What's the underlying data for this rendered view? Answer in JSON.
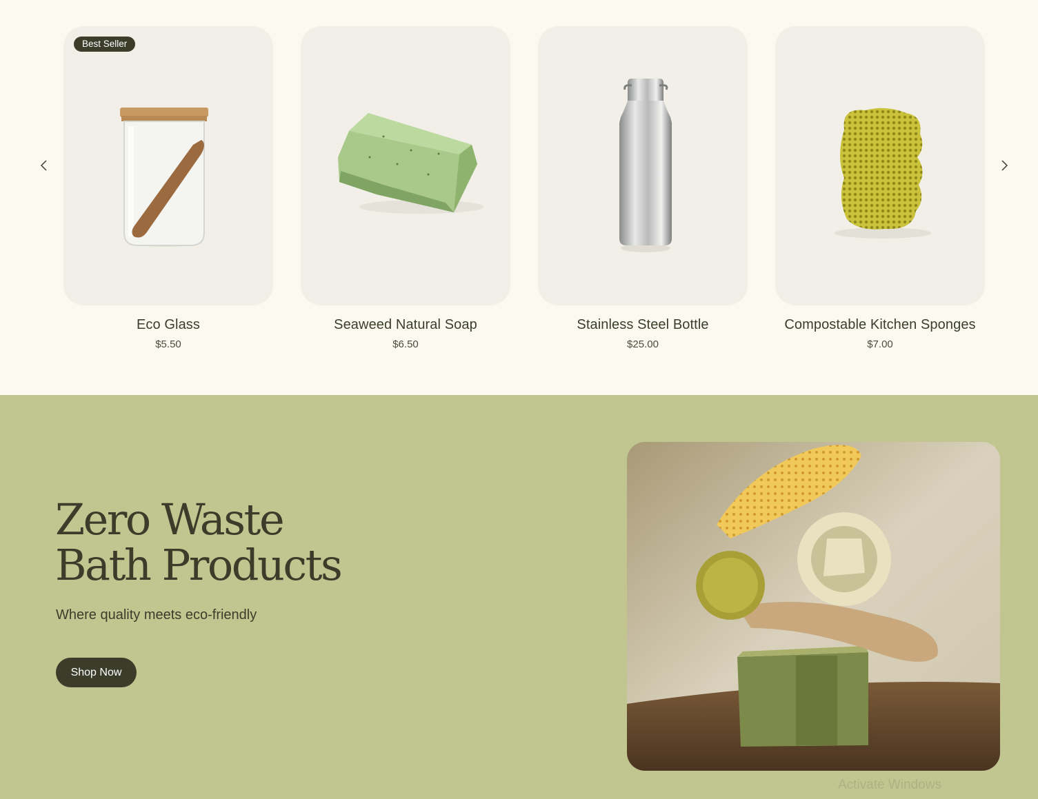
{
  "carousel": {
    "prev_icon": "chevron-left-icon",
    "next_icon": "chevron-right-icon",
    "products": [
      {
        "name": "Eco Glass",
        "price": "$5.50",
        "badge": "Best Seller",
        "image": "glass-jar-with-wooden-spoon"
      },
      {
        "name": "Seaweed Natural Soap",
        "price": "$6.50",
        "badge": "",
        "image": "green-soap-bar"
      },
      {
        "name": "Stainless Steel Bottle",
        "price": "$25.00",
        "badge": "",
        "image": "steel-water-bottle"
      },
      {
        "name": "Compostable Kitchen Sponges",
        "price": "$7.00",
        "badge": "",
        "image": "yellow-sponge"
      }
    ]
  },
  "hero": {
    "title_line1": "Zero Waste",
    "title_line2": "Bath Products",
    "subtitle": "Where quality meets eco-friendly",
    "cta_label": "Shop Now",
    "image": "bath-products-stack-photo"
  },
  "overlay": {
    "watermark": "Activate Windows"
  },
  "colors": {
    "page_bg": "#fafaf0",
    "card_bg": "#f1efe8",
    "hero_bg": "#c1c690",
    "dark": "#3b3d2a"
  }
}
